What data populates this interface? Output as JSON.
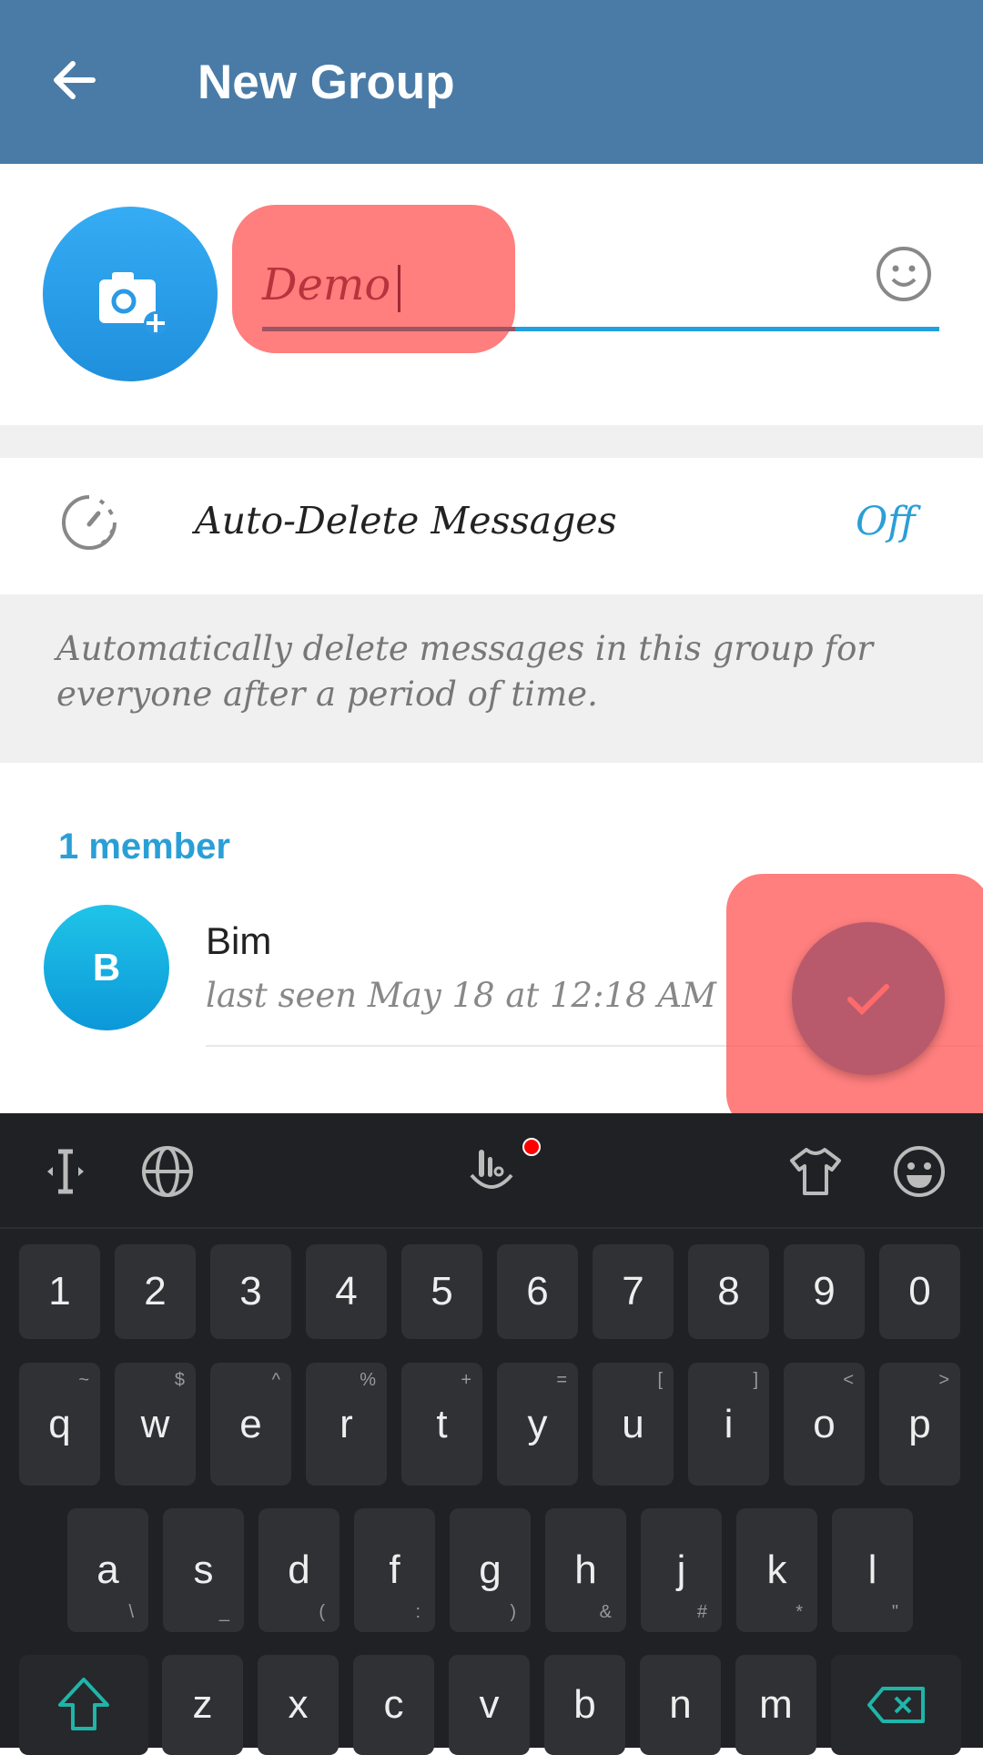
{
  "header": {
    "title": "New Group",
    "back_icon": "arrow-left-icon"
  },
  "group": {
    "name_value": "Demo",
    "photo_icon": "camera-add-icon",
    "emoji_icon": "smiley-icon"
  },
  "auto_delete": {
    "label": "Auto-Delete Messages",
    "value": "Off",
    "description": "Automatically delete messages in this group for everyone after a period of time."
  },
  "members": {
    "count_label": "1 member",
    "items": [
      {
        "initial": "B",
        "name": "Bim",
        "status": "last seen May 18 at 12:18 AM"
      }
    ]
  },
  "fab": {
    "icon": "checkmark-icon"
  },
  "keyboard": {
    "toolbar": [
      "cursor-icon",
      "globe-icon",
      "touchpal-icon",
      "theme-shirt-icon",
      "emoji-icon"
    ],
    "rows": [
      [
        {
          "k": "1"
        },
        {
          "k": "2"
        },
        {
          "k": "3"
        },
        {
          "k": "4"
        },
        {
          "k": "5"
        },
        {
          "k": "6"
        },
        {
          "k": "7"
        },
        {
          "k": "8"
        },
        {
          "k": "9"
        },
        {
          "k": "0"
        }
      ],
      [
        {
          "k": "q",
          "s": "~"
        },
        {
          "k": "w",
          "s": "$"
        },
        {
          "k": "e",
          "s": "^"
        },
        {
          "k": "r",
          "s": "%"
        },
        {
          "k": "t",
          "s": "+"
        },
        {
          "k": "y",
          "s": "="
        },
        {
          "k": "u",
          "s": "["
        },
        {
          "k": "i",
          "s": "]"
        },
        {
          "k": "o",
          "s": "<"
        },
        {
          "k": "p",
          "s": ">"
        }
      ],
      [
        {
          "k": "a",
          "s": "\\"
        },
        {
          "k": "s",
          "s": "_"
        },
        {
          "k": "d",
          "s": "("
        },
        {
          "k": "f",
          "s": ":"
        },
        {
          "k": "g",
          "s": ")"
        },
        {
          "k": "h",
          "s": "&"
        },
        {
          "k": "j",
          "s": "#"
        },
        {
          "k": "k",
          "s": "*"
        },
        {
          "k": "l",
          "s": "\""
        }
      ],
      [
        {
          "k": "z"
        },
        {
          "k": "x"
        },
        {
          "k": "c"
        },
        {
          "k": "v"
        },
        {
          "k": "b"
        },
        {
          "k": "n"
        },
        {
          "k": "m"
        }
      ]
    ],
    "accent_color": "#1fb5a8"
  }
}
